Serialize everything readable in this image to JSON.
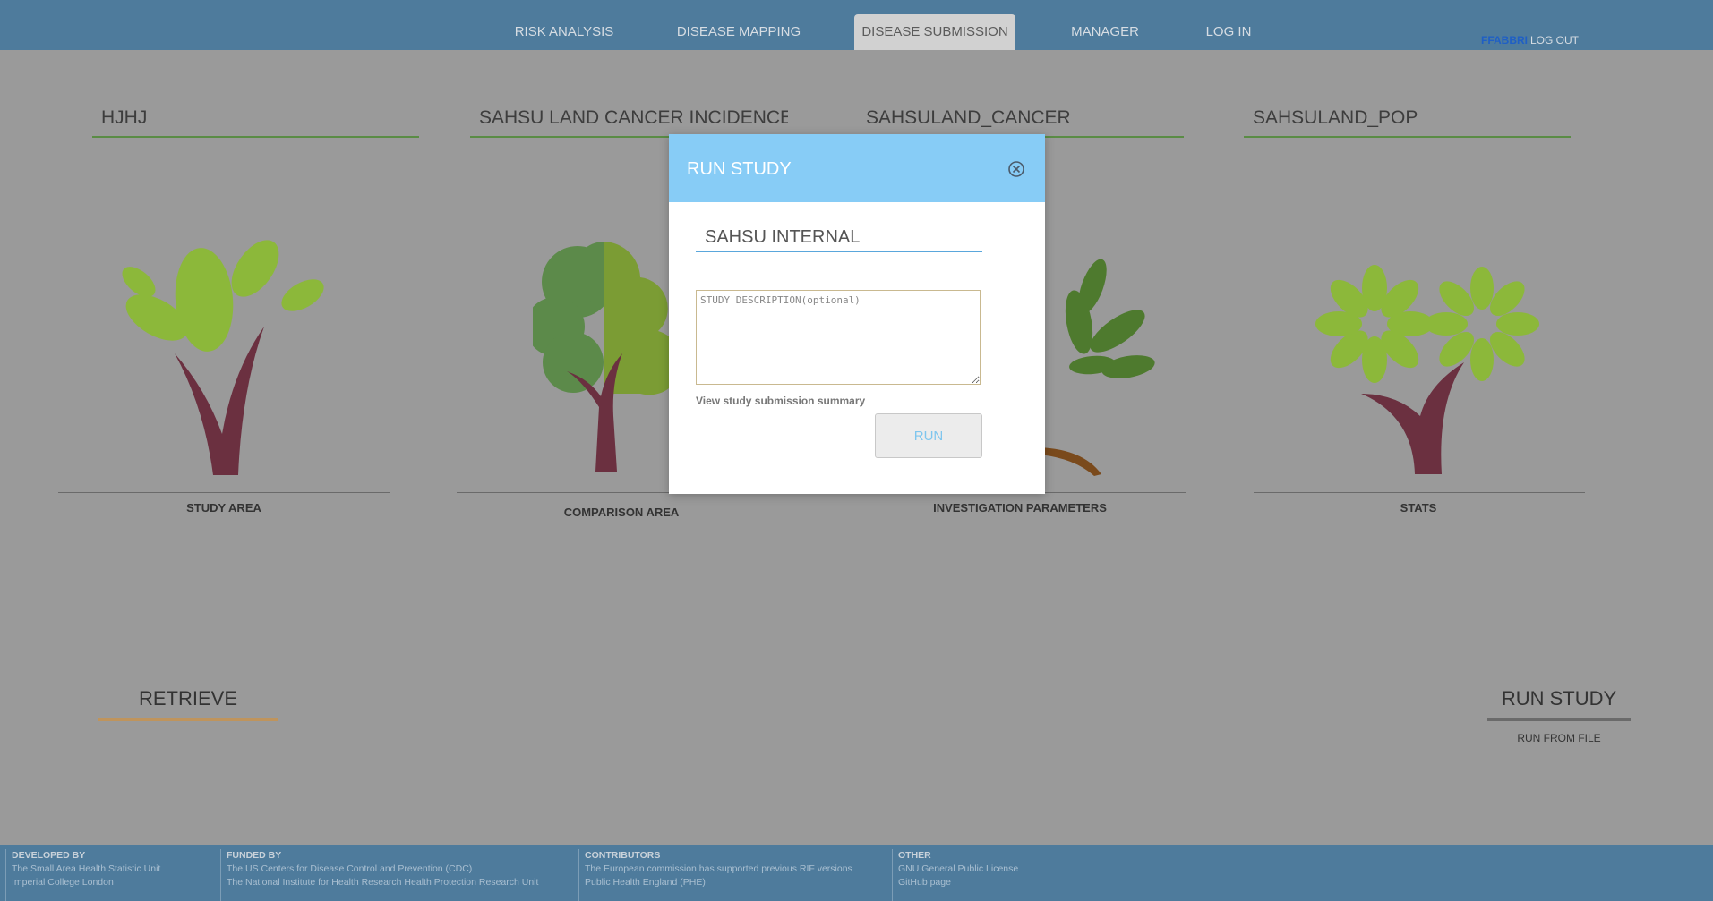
{
  "nav": {
    "tabs": [
      {
        "label": "RISK ANALYSIS"
      },
      {
        "label": "DISEASE MAPPING"
      },
      {
        "label": "DISEASE SUBMISSION",
        "active": true
      },
      {
        "label": "MANAGER"
      },
      {
        "label": "LOG IN"
      }
    ],
    "user": {
      "name": "FFABBRI",
      "logout_label": "LOG OUT"
    }
  },
  "trees": [
    {
      "title": "HJHJ",
      "label": "STUDY AREA"
    },
    {
      "title": "SAHSU LAND CANCER INCIDENCE E",
      "label": "COMPARISON AREA"
    },
    {
      "title": "SAHSULAND_CANCER",
      "label": "INVESTIGATION PARAMETERS"
    },
    {
      "title": "SAHSULAND_POP",
      "label": "STATS"
    }
  ],
  "bottom": {
    "retrieve_label": "RETRIEVE",
    "run_study_label": "RUN STUDY",
    "run_from_file_label": "RUN FROM FILE"
  },
  "modal": {
    "title": "RUN STUDY",
    "study_name_value": "SAHSU INTERNAL",
    "description_placeholder": "STUDY DESCRIPTION(optional)",
    "summary_link": "View study submission summary",
    "run_label": "RUN"
  },
  "footer": {
    "columns": [
      {
        "heading": "DEVELOPED BY",
        "lines": [
          "The Small Area Health Statistic Unit",
          "Imperial College London"
        ]
      },
      {
        "heading": "FUNDED BY",
        "lines": [
          "The US Centers for Disease Control and Prevention (CDC)",
          "The National Institute for Health Research Health Protection Research Unit"
        ]
      },
      {
        "heading": "CONTRIBUTORS",
        "lines": [
          "The European commission has supported previous RIF versions",
          "Public Health England (PHE)"
        ]
      },
      {
        "heading": "OTHER",
        "lines": [
          "GNU General Public License",
          "GitHub page"
        ]
      }
    ]
  },
  "colors": {
    "header_bg": "#4e7b9c",
    "page_bg": "#9a9a9a",
    "modal_header": "#87ccf6",
    "trunk": "#6b3040",
    "leaf_light": "#8cb83a",
    "leaf_dark": "#5a8c45"
  }
}
